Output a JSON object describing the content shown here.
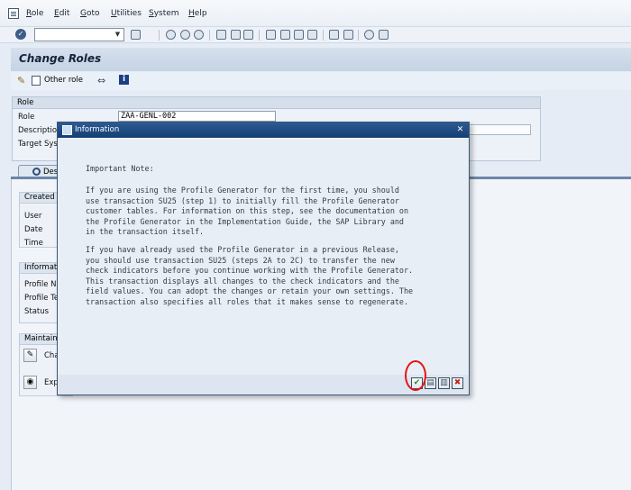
{
  "menubar": {
    "items": [
      {
        "label": "Role",
        "accel": "R"
      },
      {
        "label": "Edit",
        "accel": "E"
      },
      {
        "label": "Goto",
        "accel": "G"
      },
      {
        "label": "Utilities",
        "accel": "U"
      },
      {
        "label": "System",
        "accel": "S"
      },
      {
        "label": "Help",
        "accel": "H"
      }
    ]
  },
  "toolbar": {
    "command_value": "",
    "icons": [
      "enter-icon",
      "back-icon",
      "exit-icon",
      "cancel-icon",
      "print-icon",
      "find-icon",
      "find-next-icon",
      "first-page-icon",
      "previous-page-icon",
      "next-page-icon",
      "last-page-icon",
      "new-session-icon",
      "shortcut-icon",
      "help-icon",
      "layout-icon"
    ]
  },
  "page": {
    "title": "Change Roles"
  },
  "app_toolbar": {
    "other_role_label": "Other role"
  },
  "role_section": {
    "header": "Role",
    "role_label": "Role",
    "role_value": "ZAA-GENL-002",
    "description_label": "Description",
    "target_label": "Target Syst"
  },
  "tabs": [
    {
      "label": "Des"
    }
  ],
  "groups": {
    "created_by": {
      "header": "Created by",
      "fields": [
        "User",
        "Date",
        "Time"
      ]
    },
    "information": {
      "header": "Informatio",
      "fields": [
        "Profile Nar",
        "Profile Tex",
        "Status"
      ]
    },
    "maintain": {
      "header": "Maintain A",
      "buttons": [
        "Cha",
        "Exp"
      ]
    }
  },
  "dialog": {
    "title": "Information",
    "heading": "Important Note:",
    "para1": "If you are using the Profile Generator for the first time, you should\nuse transaction SU25 (step 1) to initially fill the Profile Generator\ncustomer tables. For information on this step, see the documentation on\nthe Profile Generator in the Implementation Guide, the SAP Library and\nin the transaction itself.",
    "para2": "If you have already used the Profile Generator in a previous Release,\nyou should use transaction SU25 (steps 2A to 2C) to transfer the new\ncheck indicators before you continue working with the Profile Generator.\nThis transaction displays all changes to the check indicators and the\nfield values. You can adopt the changes or retain your own settings. The\ntransaction also specifies all roles that it makes sense to regenerate.",
    "buttons": {
      "confirm": "✔",
      "document": "▤",
      "find": "▥",
      "cancel": "✖"
    },
    "colors": {
      "confirm": "#2a8a24",
      "cancel": "#c2231c",
      "titlebar": "#1f4b82",
      "annotation": "#e3151a"
    }
  }
}
